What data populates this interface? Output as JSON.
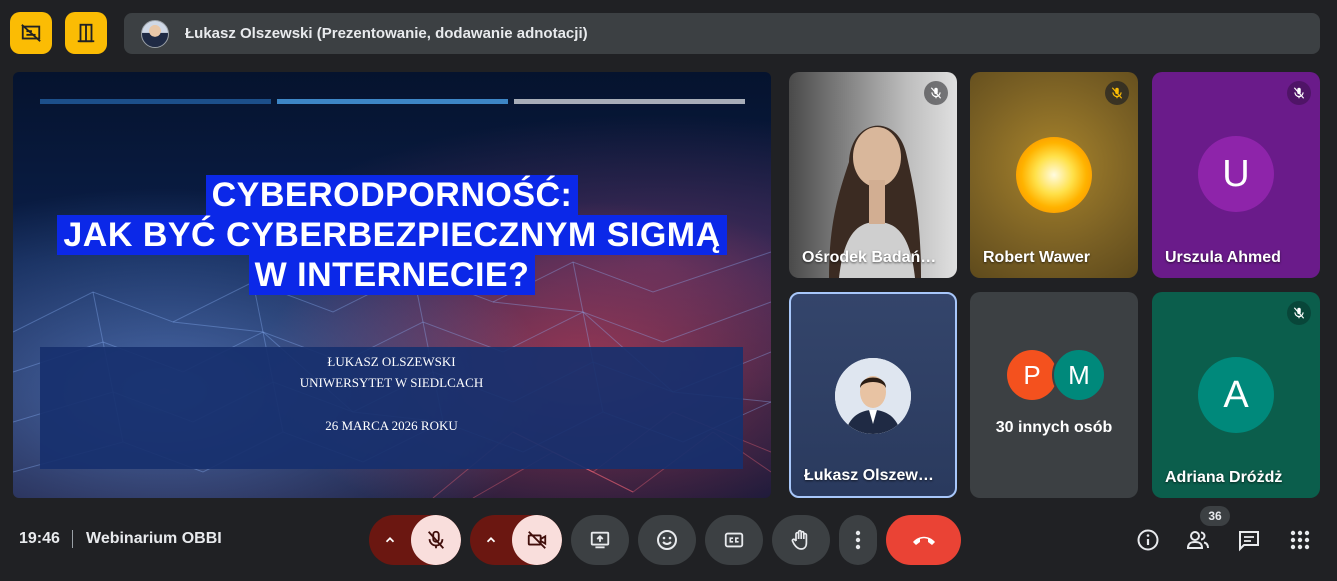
{
  "header": {
    "presenter_label": "Łukasz Olszewski (Prezentowanie, dodawanie adnotacji)"
  },
  "slide": {
    "title_lines": [
      "CYBERODPORNOŚĆ:",
      "JAK BYĆ CYBERBEZPIECZNYM SIGMĄ",
      "W INTERNECIE?"
    ],
    "author": "ŁUKASZ OLSZEWSKI",
    "institution": "UNIWERSYTET W SIEDLCACH",
    "date": "26 MARCA 2026 ROKU"
  },
  "participants": [
    {
      "name": "Ośrodek Badań…",
      "muted": true
    },
    {
      "name": "Robert Wawer",
      "muted": true
    },
    {
      "name": "Urszula Ahmed",
      "initial": "U",
      "muted": true
    },
    {
      "name": "Łukasz Olszew…",
      "muted": false
    },
    {
      "name": "30 innych osób",
      "initials": [
        "P",
        "M"
      ]
    },
    {
      "name": "Adriana Dróżdż",
      "initial": "A",
      "muted": true
    }
  ],
  "footer": {
    "time": "19:46",
    "meeting_name": "Webinarium OBBI",
    "people_count": "36"
  },
  "colors": {
    "accent_yellow": "#fbbc04",
    "end_call_red": "#ea4335",
    "title_highlight": "#0b28e8",
    "tile_bg": "#3c4043"
  },
  "icons": [
    "stop-presenting-icon",
    "exit-door-icon",
    "mic-off-icon",
    "camera-off-icon",
    "present-screen-icon",
    "emoji-icon",
    "captions-icon",
    "raise-hand-icon",
    "more-options-icon",
    "end-call-icon",
    "info-icon",
    "people-icon",
    "chat-icon",
    "apps-icon"
  ]
}
